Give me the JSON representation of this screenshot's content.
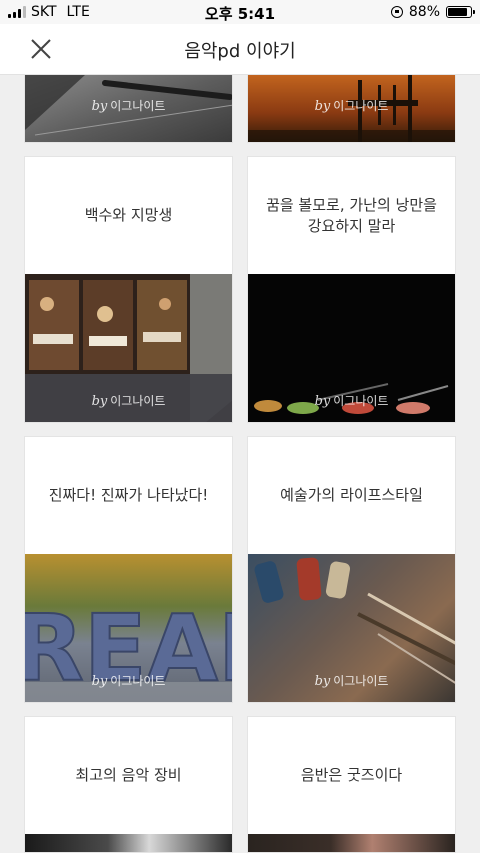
{
  "status_bar": {
    "carrier": "SKT",
    "network": "LTE",
    "time": "오후 5:41",
    "battery": "88%",
    "battery_level": 0.88
  },
  "header": {
    "title": "음악pd 이야기",
    "close_icon": "close-icon"
  },
  "byline": {
    "by": "by",
    "author": "이그나이트"
  },
  "cards": [
    {
      "title": "",
      "image": "notebook-pen-photo"
    },
    {
      "title": "",
      "image": "chair-autumn-photo"
    },
    {
      "title": "백수와 지망생",
      "image": "cafe-window-photo"
    },
    {
      "title": "꿈을 볼모로, 가난의 낭만을 강요하지 말라",
      "image": "dark-bowls-photo"
    },
    {
      "title": "진짜다! 진짜가 나타났다!",
      "image": "real-letters-photo"
    },
    {
      "title": "예술가의 라이프스타일",
      "image": "paint-tubes-photo"
    },
    {
      "title": "최고의 음악 장비",
      "image": "equipment-photo"
    },
    {
      "title": "음반은 굿즈이다",
      "image": "hand-photo"
    }
  ],
  "colors": {
    "background": "#efefef",
    "card": "#ffffff",
    "title_text": "#333333"
  }
}
